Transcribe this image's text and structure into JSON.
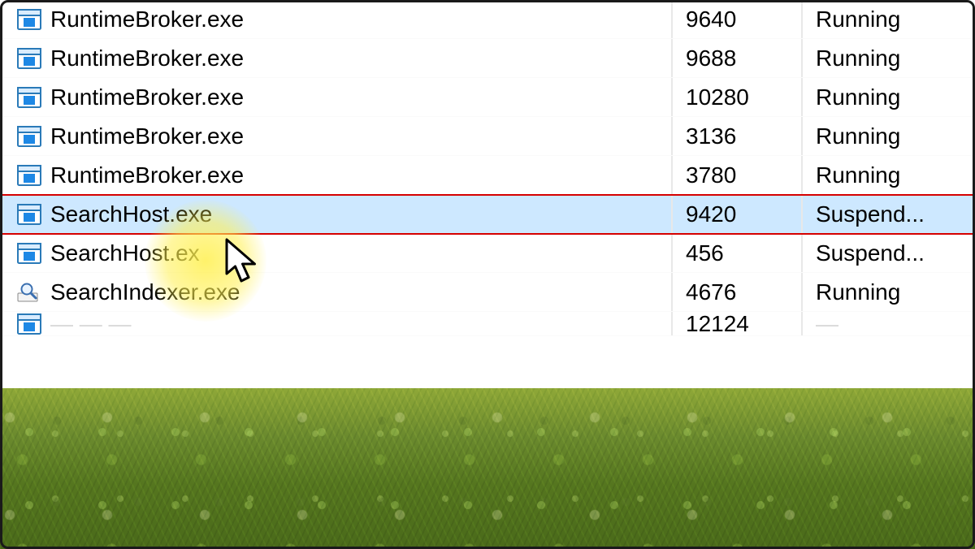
{
  "processes": [
    {
      "name": "RuntimeBroker.exe",
      "pid": "9640",
      "status": "Running",
      "icon": "app",
      "selected": false
    },
    {
      "name": "RuntimeBroker.exe",
      "pid": "9688",
      "status": "Running",
      "icon": "app",
      "selected": false
    },
    {
      "name": "RuntimeBroker.exe",
      "pid": "10280",
      "status": "Running",
      "icon": "app",
      "selected": false
    },
    {
      "name": "RuntimeBroker.exe",
      "pid": "3136",
      "status": "Running",
      "icon": "app",
      "selected": false
    },
    {
      "name": "RuntimeBroker.exe",
      "pid": "3780",
      "status": "Running",
      "icon": "app",
      "selected": false
    },
    {
      "name": "SearchHost.exe",
      "pid": "9420",
      "status": "Suspend...",
      "icon": "app",
      "selected": true
    },
    {
      "name": "SearchHost.ex",
      "pid": "456",
      "status": "Suspend...",
      "icon": "app",
      "selected": false
    },
    {
      "name": "SearchIndexer.exe",
      "pid": "4676",
      "status": "Running",
      "icon": "search",
      "selected": false
    }
  ],
  "partial_row": {
    "pid_fragment": "12124"
  },
  "colors": {
    "selection": "#cde8ff",
    "highlight_border": "#d60000"
  }
}
